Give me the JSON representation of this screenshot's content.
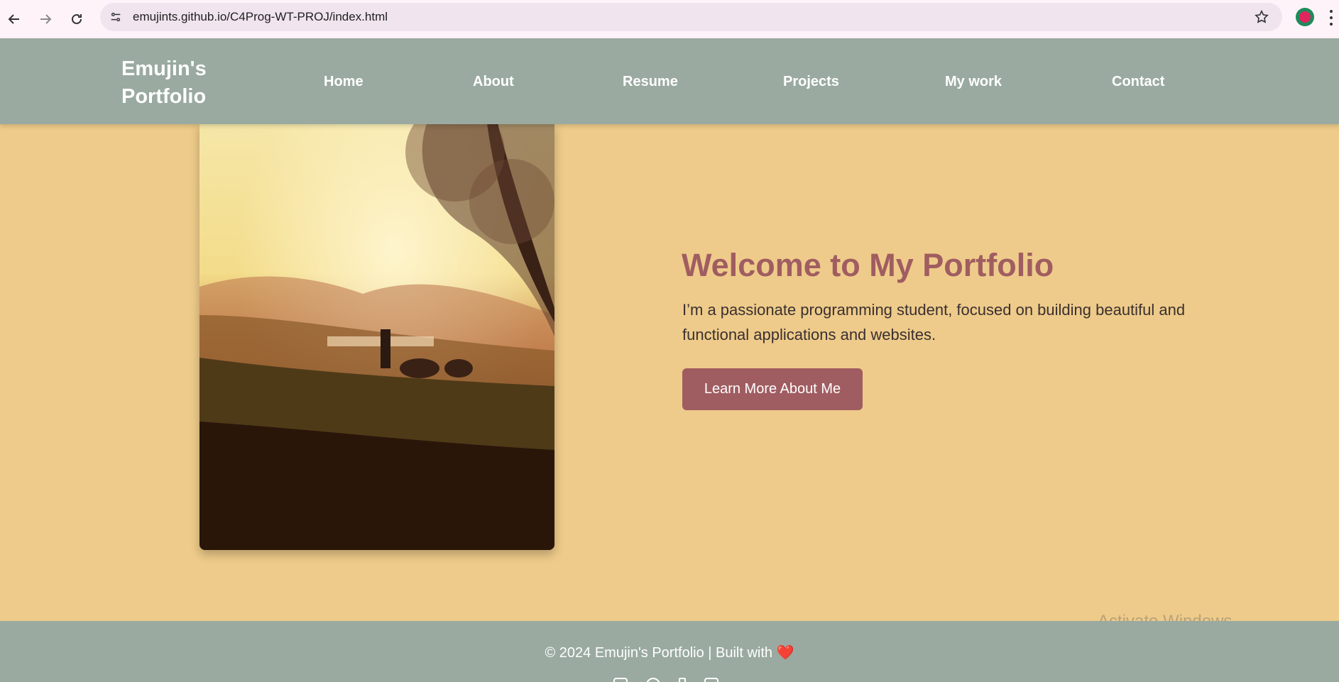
{
  "browser": {
    "url": "emujints.github.io/C4Prog-WT-PROJ/index.html",
    "icons": [
      "back-arrow-icon",
      "forward-arrow-icon",
      "reload-icon",
      "site-info-icon",
      "star-icon",
      "profile-icon",
      "kebab-menu-icon"
    ]
  },
  "header": {
    "logo_line1": "Emujin's",
    "logo_line2": "Portfolio",
    "nav": [
      "Home",
      "About",
      "Resume",
      "Projects",
      "My work",
      "Contact"
    ]
  },
  "hero": {
    "title": "Welcome to My Portfolio",
    "text_line1": "I’m a passionate programming student, focused on building beautiful and",
    "text_line2": "functional applications and websites.",
    "cta_label": "Learn More About Me"
  },
  "footer": {
    "copyright": "© 2024 Emujin's Portfolio | Built with",
    "heart": "❤️"
  },
  "os": {
    "watermark": "Activate Windows"
  },
  "colors": {
    "page_bg": "#eecb8a",
    "header_bg": "#9aaaa0",
    "accent": "#a05d61",
    "text": "#3a3030"
  }
}
